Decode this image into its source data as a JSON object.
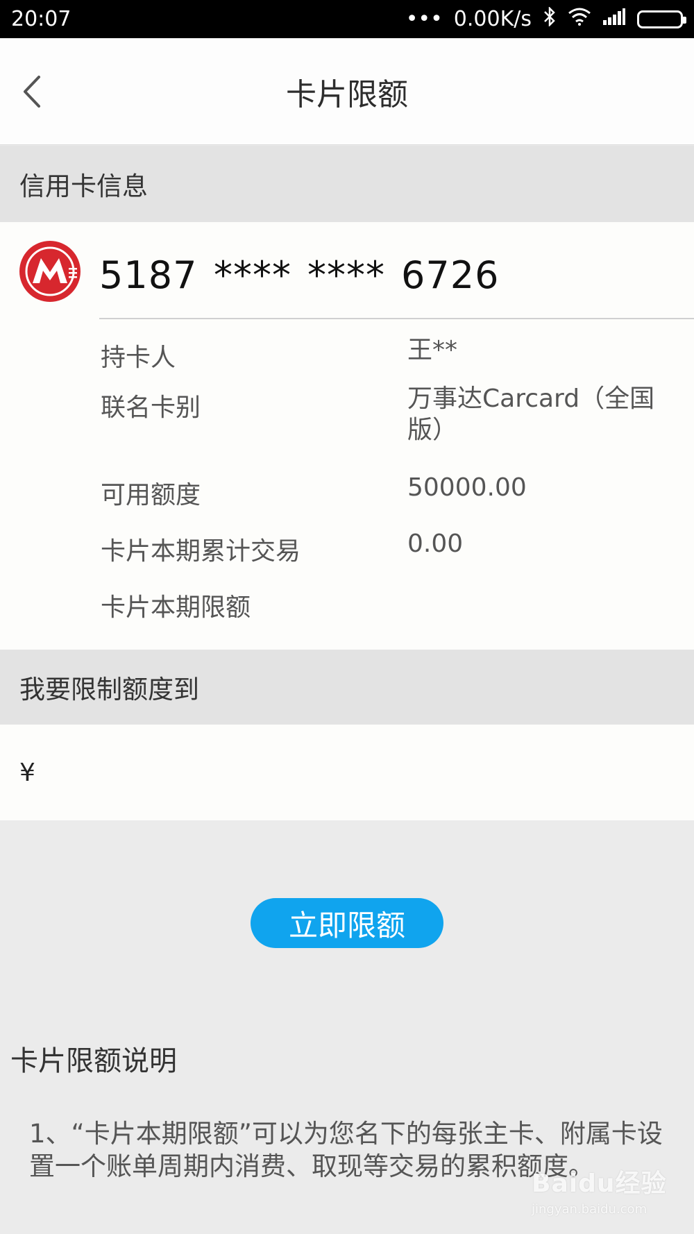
{
  "status_bar": {
    "time": "20:07",
    "dots": "•••",
    "speed": "0.00K/s",
    "icons": [
      "bluetooth-icon",
      "wifi-icon",
      "signal-icon",
      "battery-icon"
    ]
  },
  "nav": {
    "title": "卡片限额",
    "back_icon": "chevron-left-icon"
  },
  "sections": {
    "card_info_header": "信用卡信息",
    "limit_header": "我要限制额度到"
  },
  "card": {
    "logo": "china-merchants-bank-logo",
    "number_groups": [
      "5187",
      "****",
      "****",
      "6726"
    ],
    "rows": [
      {
        "label": "持卡人",
        "value": "王**"
      },
      {
        "label": "联名卡别",
        "value": "万事达Carcard（全国版）"
      },
      {
        "label": "可用额度",
        "value": "50000.00"
      },
      {
        "label": "卡片本期累计交易",
        "value": "0.00"
      },
      {
        "label": "卡片本期限额",
        "value": ""
      }
    ]
  },
  "limit_input": {
    "currency_symbol": "¥",
    "value": "",
    "placeholder": ""
  },
  "submit_label": "立即限额",
  "explanation": {
    "title": "卡片限额说明",
    "text": "1、“卡片本期限额”可以为您名下的每张主卡、附属卡设置一个账单周期内消费、取现等交易的累积额度。"
  },
  "watermark": {
    "main": "Baidu经验",
    "sub": "jingyan.baidu.com"
  },
  "colors": {
    "accent": "#10a4ee",
    "logo_red": "#d7272e",
    "section_bg": "#e3e3e3",
    "page_bg": "#ebebeb"
  }
}
